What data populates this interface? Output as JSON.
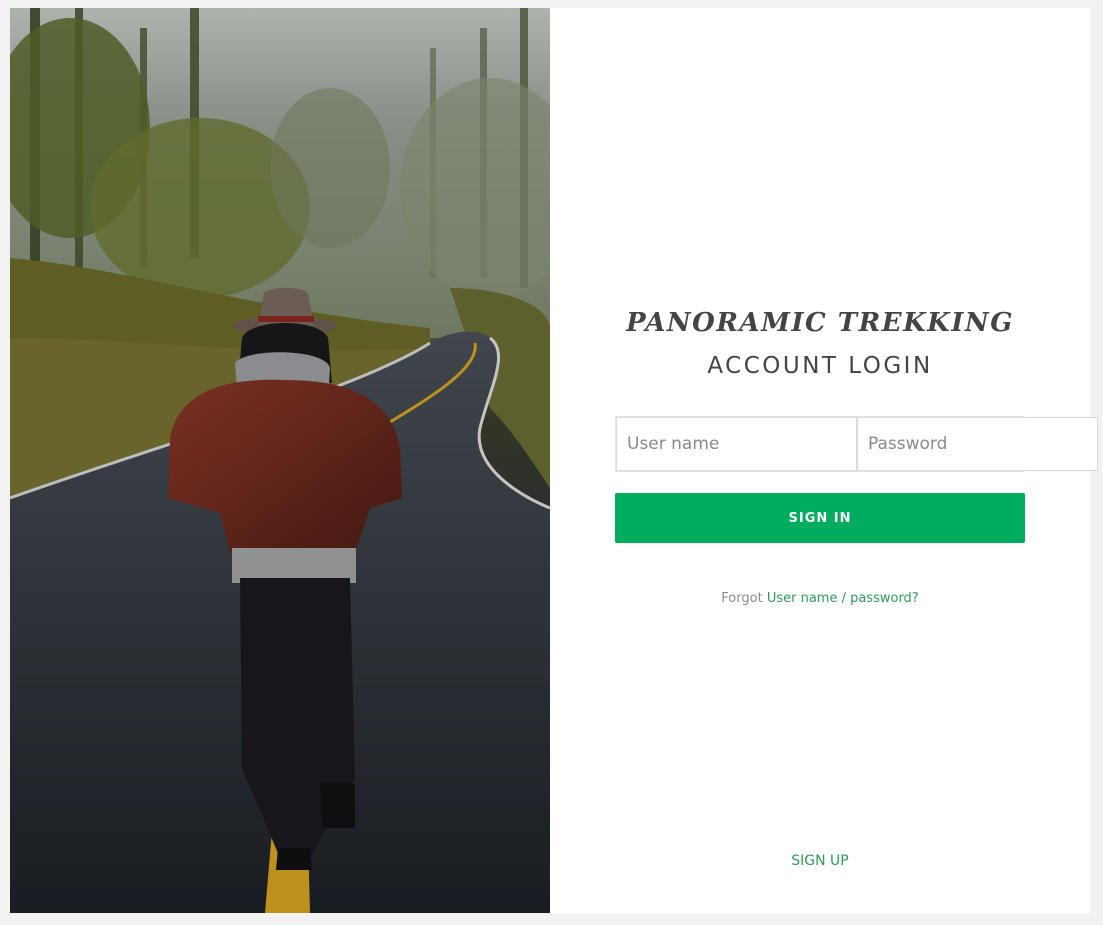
{
  "hero": {
    "image": "traveler-on-road-photo"
  },
  "login": {
    "brand": "PANORAMIC TREKKING",
    "title": "ACCOUNT LOGIN",
    "username_placeholder": "User name",
    "password_placeholder": "Password",
    "signin_label": "SIGN IN",
    "forgot_prefix": "Forgot",
    "forgot_link": "User name / password?",
    "signup_label": "SIGN UP"
  },
  "colors": {
    "accent": "#00ad5f",
    "link": "#2e9a5e",
    "text": "#444444",
    "page_bg": "#f2f2f2"
  }
}
